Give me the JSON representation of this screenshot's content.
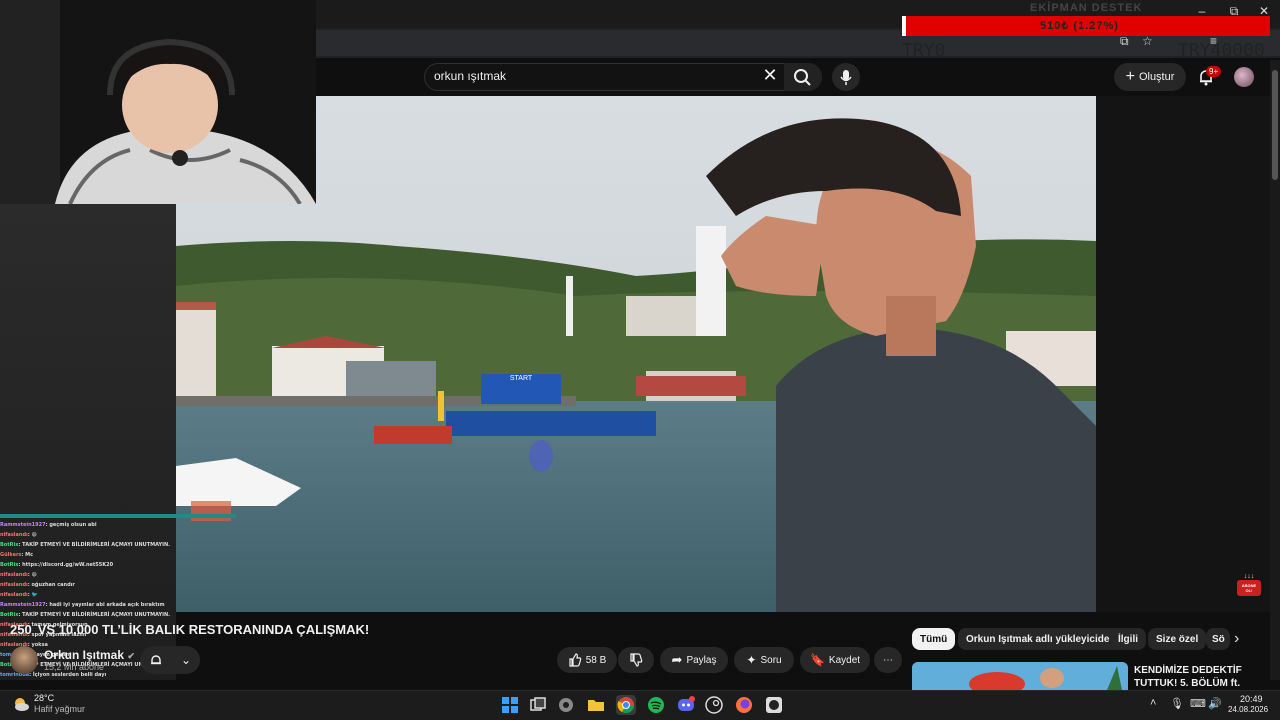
{
  "overlay": {
    "donation_title": "EKİPMAN DESTEK",
    "donation_amount": "510₺ (1.27%)",
    "try_left": "TRY0",
    "try_right": "TRY40000"
  },
  "browser": {
    "minimize": "–",
    "maximize": "⧉",
    "close": "✕"
  },
  "youtube": {
    "search": {
      "query": "orkun ışıtmak",
      "clear_glyph": "✕"
    },
    "create_label": "Oluştur",
    "notification_badge": "9+",
    "video": {
      "rank": "250",
      "title": "VS 10.000 TL’LİK BALIK RESTORANINDA ÇALIŞMAK!",
      "channel": "Orkun Işıtmak",
      "subscribers": "15,2 Mn abone",
      "boat_sign": "START",
      "subscribe_sticker": "ABONE OL!"
    },
    "actions": {
      "likes": "58 B",
      "share": "Paylaş",
      "ask": "Soru",
      "save": "Kaydet",
      "more": "⋯"
    },
    "chips": [
      "Tümü",
      "Orkun Işıtmak adlı yükleyiciden",
      "İlgili",
      "Size özel",
      "Sö"
    ],
    "recommended": {
      "title": "KENDİMİZE DEDEKTİF TUTTUK! 5. BÖLÜM ft."
    }
  },
  "chat": [
    {
      "user": "Rammstein1927",
      "text": ": geçmiş olsun abi",
      "color": "#c084fc"
    },
    {
      "user": "nifaslandı",
      "text": ": 😄",
      "color": "#f87171"
    },
    {
      "user": "BotRix",
      "text": ": TAKİP ETMEYİ VE BİLDİRİMLERİ AÇMAYI UNUTMAYIN.",
      "color": "#4ade80"
    },
    {
      "user": "Gülkers",
      "text": ": Mc",
      "color": "#f87171"
    },
    {
      "user": "BotRix",
      "text": ": https://discord.gg/wW.net55K20",
      "color": "#4ade80"
    },
    {
      "user": "nifaslandı",
      "text": ": 😄",
      "color": "#f87171"
    },
    {
      "user": "nifaslandı",
      "text": ": oğuzhan candır",
      "color": "#f87171"
    },
    {
      "user": "nifaslandı",
      "text": ": 🐦",
      "color": "#f87171"
    },
    {
      "user": "Rammstein1927",
      "text": ": hadi iyi yayınlar abi arkada açık bıraktım",
      "color": "#c084fc"
    },
    {
      "user": "BotRix",
      "text": ": TAKİP ETMEYİ VE BİLDİRİMLERİ AÇMAYI UNUTMAYIN.",
      "color": "#4ade80"
    },
    {
      "user": "nifaslandı",
      "text": ": tamam gelmiyorsun",
      "color": "#f87171"
    },
    {
      "user": "nifaslandı",
      "text": ": spor yapmam lazım",
      "color": "#f87171"
    },
    {
      "user": "nifaslandı",
      "text": ": yoksa",
      "color": "#f87171"
    },
    {
      "user": "tomrinoda",
      "text": ": dayım geldim",
      "color": "#60a5fa"
    },
    {
      "user": "BotRix",
      "text": ": TAKİP ETMEYİ VE BİLDİRİMLERİ AÇMAYI UNUTMAYIN.",
      "color": "#4ade80"
    },
    {
      "user": "tomrinoda",
      "text": ": İçiyon seslerden belli dayı",
      "color": "#60a5fa"
    }
  ],
  "taskbar": {
    "temperature": "28°C",
    "weather": "Hafif yağmur",
    "time": "20:49",
    "date": "24.08.2026",
    "apps": [
      "windows-start",
      "task-view",
      "settings",
      "file-explorer",
      "chrome",
      "spotify",
      "discord",
      "steam",
      "firefox",
      "obs"
    ]
  },
  "colors": {
    "youtube_bg": "#0f0f0f",
    "donation_red": "#e00000",
    "chat_accent": "#1e8c86",
    "badge_red": "#cc0000"
  }
}
